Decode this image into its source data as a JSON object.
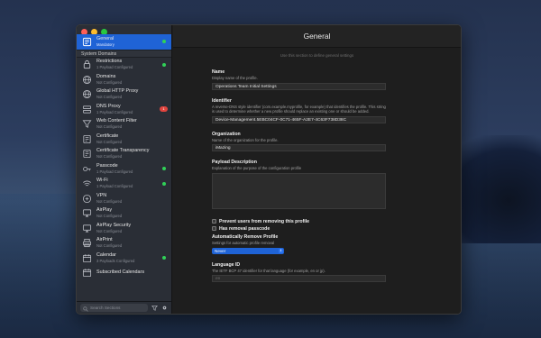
{
  "window": {
    "title": "General",
    "subtitle": "Use this section to define general settings"
  },
  "sidebar": {
    "selected": {
      "name": "General",
      "status": "Mandatory",
      "icon": "profile-icon"
    },
    "section_header": "System Domains",
    "items": [
      {
        "name": "Restrictions",
        "status": "1 Payload Configured",
        "icon": "lock-icon",
        "indicator": "dot"
      },
      {
        "name": "Domains",
        "status": "Not Configured",
        "icon": "globe-icon",
        "indicator": ""
      },
      {
        "name": "Global HTTP Proxy",
        "status": "Not Configured",
        "icon": "globe-icon",
        "indicator": ""
      },
      {
        "name": "DNS Proxy",
        "status": "1 Payload Configured",
        "icon": "dns-icon",
        "indicator": "badge",
        "badge": "1"
      },
      {
        "name": "Web Content Filter",
        "status": "Not Configured",
        "icon": "filter-icon",
        "indicator": ""
      },
      {
        "name": "Certificate",
        "status": "Not Configured",
        "icon": "certificate-icon",
        "indicator": ""
      },
      {
        "name": "Certificate Transparency",
        "status": "Not Configured",
        "icon": "certificate-icon",
        "indicator": ""
      },
      {
        "name": "Passcode",
        "status": "1 Payload Configured",
        "icon": "key-icon",
        "indicator": "dot"
      },
      {
        "name": "Wi-Fi",
        "status": "1 Payload Configured",
        "icon": "wifi-icon",
        "indicator": "dot"
      },
      {
        "name": "VPN",
        "status": "Not Configured",
        "icon": "vpn-icon",
        "indicator": ""
      },
      {
        "name": "AirPlay",
        "status": "Not Configured",
        "icon": "airplay-icon",
        "indicator": ""
      },
      {
        "name": "AirPlay Security",
        "status": "Not Configured",
        "icon": "airplay-icon",
        "indicator": ""
      },
      {
        "name": "AirPrint",
        "status": "Not Configured",
        "icon": "printer-icon",
        "indicator": ""
      },
      {
        "name": "Calendar",
        "status": "3 Payloads Configured",
        "icon": "calendar-icon",
        "indicator": "dot"
      },
      {
        "name": "Subscribed Calendars",
        "status": "",
        "icon": "calendar-icon",
        "indicator": ""
      }
    ],
    "search_placeholder": "Search Sections"
  },
  "form": {
    "name": {
      "label": "Name",
      "desc": "Display name of the profile.",
      "value": "Operations Team Initial Settings"
    },
    "identifier": {
      "label": "Identifier",
      "desc": "A reverse-DNS style identifier (com.example.myprofile, for example) that identifies the profile. This string is used to determine whether a new profile should replace an existing one or should be added.",
      "value": "Device-Management.5EBC04CF-0C71-465F-A2E7-4C63F738D38C"
    },
    "organization": {
      "label": "Organization",
      "desc": "Name of the organization for the profile.",
      "value": "iMazing"
    },
    "payload_description": {
      "label": "Payload Description",
      "desc": "Explanation of the purpose of the configuration profile"
    },
    "prevent_removal": "Prevent users from removing this profile",
    "has_removal_passcode": "Has removal passcode",
    "auto_remove": {
      "label": "Automatically Remove Profile",
      "desc": "Settings for automatic profile removal",
      "value": "Never"
    },
    "language": {
      "label": "Language ID",
      "desc": "The IETF BCP 47 identifier for that language (for example, en or jp).",
      "placeholder": "en"
    }
  },
  "colors": {
    "accent": "#1f63d6",
    "configured_dot": "#30d158",
    "badge": "#e0443e"
  }
}
